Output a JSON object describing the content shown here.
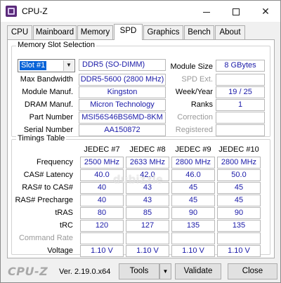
{
  "window": {
    "title": "CPU-Z",
    "minimize_glyph": "",
    "close_glyph": "✕"
  },
  "tabs": [
    {
      "label": "CPU"
    },
    {
      "label": "Mainboard"
    },
    {
      "label": "Memory"
    },
    {
      "label": "SPD",
      "active": true
    },
    {
      "label": "Graphics"
    },
    {
      "label": "Bench"
    },
    {
      "label": "About"
    }
  ],
  "slot": {
    "group_title": "Memory Slot Selection",
    "selected": "Slot #1",
    "module_type": "DDR5 (SO-DIMM)",
    "labels": {
      "max_bandwidth": "Max Bandwidth",
      "module_manuf": "Module Manuf.",
      "dram_manuf": "DRAM Manuf.",
      "part_number": "Part Number",
      "serial_number": "Serial Number",
      "module_size": "Module Size",
      "spd_ext": "SPD Ext.",
      "week_year": "Week/Year",
      "ranks": "Ranks",
      "correction": "Correction",
      "registered": "Registered"
    },
    "values": {
      "max_bandwidth": "DDR5-5600 (2800 MHz)",
      "module_manuf": "Kingston",
      "dram_manuf": "Micron Technology",
      "part_number": "MSI56S46BS6MD-8KM",
      "serial_number": "AA150872",
      "module_size": "8 GBytes",
      "spd_ext": "",
      "week_year": "19 / 25",
      "ranks": "1",
      "correction": "",
      "registered": ""
    }
  },
  "timings": {
    "group_title": "Timings Table",
    "columns": [
      "JEDEC #7",
      "JEDEC #8",
      "JEDEC #9",
      "JEDEC #10"
    ],
    "rows": [
      {
        "label": "Frequency",
        "values": [
          "2500 MHz",
          "2633 MHz",
          "2800 MHz",
          "2800 MHz"
        ]
      },
      {
        "label": "CAS# Latency",
        "values": [
          "40.0",
          "42.0",
          "46.0",
          "50.0"
        ]
      },
      {
        "label": "RAS# to CAS#",
        "values": [
          "40",
          "43",
          "45",
          "45"
        ]
      },
      {
        "label": "RAS# Precharge",
        "values": [
          "40",
          "43",
          "45",
          "45"
        ]
      },
      {
        "label": "tRAS",
        "values": [
          "80",
          "85",
          "90",
          "90"
        ]
      },
      {
        "label": "tRC",
        "values": [
          "120",
          "127",
          "135",
          "135"
        ]
      },
      {
        "label": "Command Rate",
        "disabled": true,
        "values": [
          "",
          "",
          "",
          ""
        ]
      },
      {
        "label": "Voltage",
        "values": [
          "1.10 V",
          "1.10 V",
          "1.10 V",
          "1.10 V"
        ]
      }
    ]
  },
  "footer": {
    "logo": "CPU-Z",
    "version": "Ver. 2.19.0.x64",
    "tools_label": "Tools",
    "tools_arrow": "▼",
    "validate_label": "Validate",
    "close_label": "Close"
  },
  "watermark": "dubizzle"
}
